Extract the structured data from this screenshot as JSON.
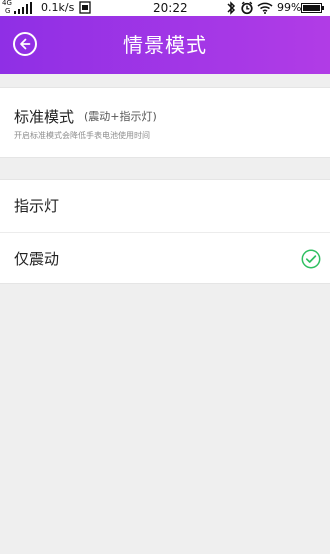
{
  "status_bar": {
    "network_top": "4G",
    "network_bottom": "G",
    "speed": "0.1k/s",
    "time": "20:22",
    "battery_percent": "99%",
    "icons": [
      "signal-icon",
      "screenshot-icon",
      "bluetooth-icon",
      "alarm-icon",
      "wifi-icon",
      "battery-icon"
    ]
  },
  "header": {
    "title": "情景模式",
    "back_icon": "back-arrow-icon"
  },
  "standard_mode": {
    "title": "标准模式",
    "subtitle": "(震动+指示灯)",
    "description": "开启标准模式会降低手表电池使用时间"
  },
  "options": [
    {
      "label": "指示灯",
      "selected": false
    },
    {
      "label": "仅震动",
      "selected": true
    }
  ],
  "colors": {
    "header_start": "#8f2fe5",
    "header_end": "#b13ce6",
    "background": "#efefef",
    "check": "#2fbf61"
  }
}
